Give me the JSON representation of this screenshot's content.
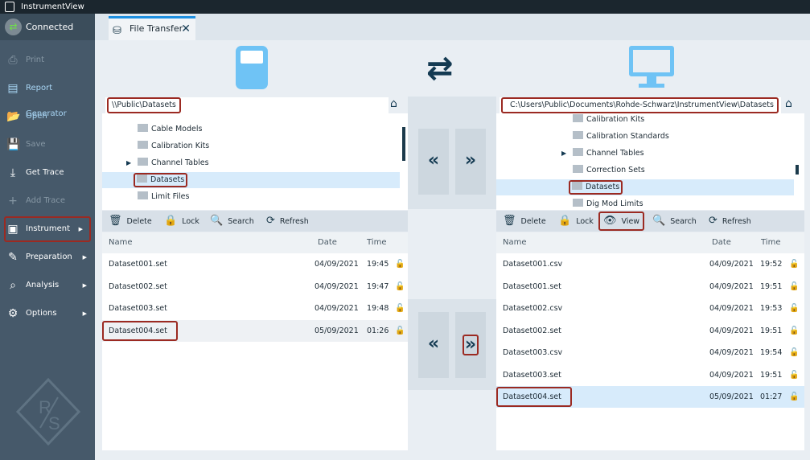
{
  "app": {
    "title": "InstrumentView",
    "status": "Connected"
  },
  "sidebar": {
    "items": [
      {
        "label": "Print",
        "icon": "printer-icon",
        "state": "disabled"
      },
      {
        "label": "Report Generator",
        "icon": "report-icon",
        "state": "active"
      },
      {
        "label": "Open",
        "icon": "open-icon",
        "state": "active"
      },
      {
        "label": "Save",
        "icon": "save-icon",
        "state": "disabled"
      },
      {
        "label": "Get Trace",
        "icon": "get-trace-icon",
        "state": "normal"
      },
      {
        "label": "Add Trace",
        "icon": "add-trace-icon",
        "state": "disabled"
      },
      {
        "label": "Instrument",
        "icon": "instrument-icon",
        "state": "highlighted"
      },
      {
        "label": "Preparation",
        "icon": "pencil-icon",
        "state": "normal"
      },
      {
        "label": "Analysis",
        "icon": "analysis-icon",
        "state": "normal"
      },
      {
        "label": "Options",
        "icon": "gear-icon",
        "state": "normal"
      }
    ]
  },
  "tab": {
    "label": "File Transfer"
  },
  "left": {
    "path": "\\\\Public\\Datasets",
    "tree": [
      {
        "label": "Cable Models"
      },
      {
        "label": "Calibration Kits"
      },
      {
        "label": "Channel Tables",
        "expandable": true
      },
      {
        "label": "Datasets",
        "selected": true
      },
      {
        "label": "Limit Files"
      }
    ],
    "toolbar": [
      "Delete",
      "Lock",
      "Search",
      "Refresh"
    ],
    "columns": [
      "Name",
      "Date",
      "Time"
    ],
    "files": [
      {
        "name": "Dataset001.set",
        "date": "04/09/2021",
        "time": "19:45"
      },
      {
        "name": "Dataset002.set",
        "date": "04/09/2021",
        "time": "19:47"
      },
      {
        "name": "Dataset003.set",
        "date": "04/09/2021",
        "time": "19:48"
      },
      {
        "name": "Dataset004.set",
        "date": "05/09/2021",
        "time": "01:26"
      }
    ]
  },
  "right": {
    "path": "C:\\Users\\Public\\Documents\\Rohde-Schwarz\\InstrumentView\\Datasets",
    "tree": [
      {
        "label": "Calibration Kits"
      },
      {
        "label": "Calibration Standards"
      },
      {
        "label": "Channel Tables",
        "expandable": true
      },
      {
        "label": "Correction Sets"
      },
      {
        "label": "Datasets",
        "selected": true
      },
      {
        "label": "Dig Mod Limits"
      }
    ],
    "toolbar": [
      "Delete",
      "Lock",
      "View",
      "Search",
      "Refresh"
    ],
    "columns": [
      "Name",
      "Date",
      "Time"
    ],
    "files": [
      {
        "name": "Dataset001.csv",
        "date": "04/09/2021",
        "time": "19:52"
      },
      {
        "name": "Dataset001.set",
        "date": "04/09/2021",
        "time": "19:51"
      },
      {
        "name": "Dataset002.csv",
        "date": "04/09/2021",
        "time": "19:53"
      },
      {
        "name": "Dataset002.set",
        "date": "04/09/2021",
        "time": "19:51"
      },
      {
        "name": "Dataset003.csv",
        "date": "04/09/2021",
        "time": "19:54"
      },
      {
        "name": "Dataset003.set",
        "date": "04/09/2021",
        "time": "19:51"
      },
      {
        "name": "Dataset004.set",
        "date": "05/09/2021",
        "time": "01:27"
      }
    ]
  },
  "transfer": {
    "left": "«",
    "right": "»"
  },
  "colors": {
    "accent": "#1e8fe0",
    "highlight": "#9b2a22",
    "sidebar": "#46596a",
    "selection": "#d7ebfb"
  }
}
